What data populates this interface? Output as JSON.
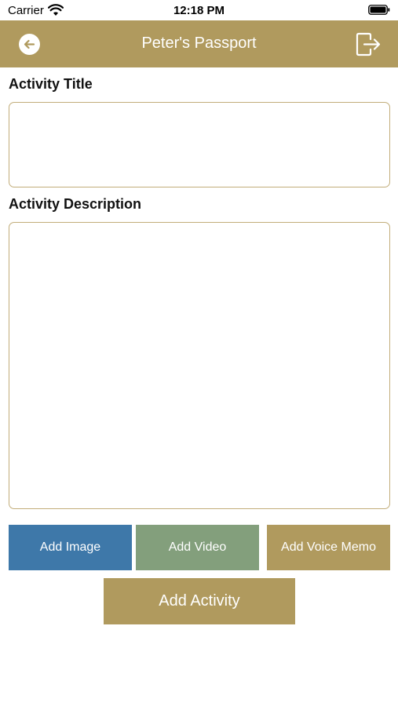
{
  "status_bar": {
    "carrier": "Carrier",
    "time": "12:18 PM"
  },
  "nav": {
    "title": "Peter's Passport",
    "back_icon": "arrow-left-circle-icon",
    "logout_icon": "logout-icon"
  },
  "form": {
    "title_label": "Activity Title",
    "title_value": "",
    "description_label": "Activity Description",
    "description_value": ""
  },
  "buttons": {
    "add_image": "Add Image",
    "add_video": "Add Video",
    "add_voice_memo": "Add Voice Memo",
    "add_activity": "Add Activity"
  },
  "colors": {
    "brand": "#b09a5e",
    "add_image": "#3e78a9",
    "add_video": "#839f7c",
    "add_voice_memo": "#b09a5e",
    "add_activity": "#b09a5e"
  }
}
